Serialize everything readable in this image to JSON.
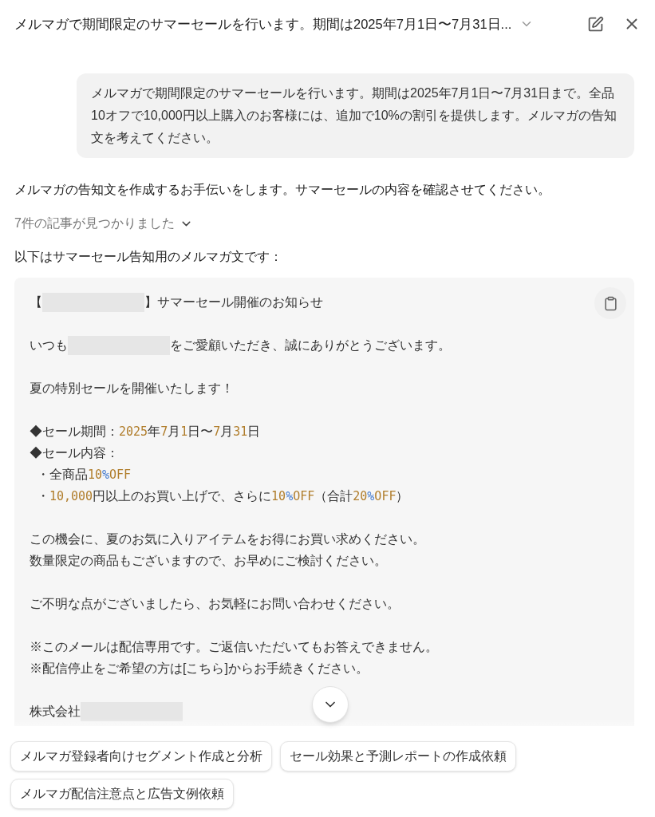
{
  "header": {
    "title": "メルマガで期間限定のサマーセールを行います。期間は2025年7月1日〜7月31日..."
  },
  "user_message": {
    "text": "メルマガで期間限定のサマーセールを行います。期間は2025年7月1日〜7月31日まで。全品10オフで10,000円以上購入のお客様には、追加で10%の割引を提供します。メルマガの告知文を考えてください。"
  },
  "assistant_intro": "メルマガの告知文を作成するお手伝いをします。サマーセールの内容を確認させてください。",
  "sources": {
    "label": "7件の記事が見つかりました",
    "expanded": false
  },
  "lead": "以下はサマーセール告知用のメルマガ文です：",
  "code_block": {
    "lines": [
      {
        "kind": "text",
        "segments": [
          {
            "kind": "plain",
            "text": "【"
          },
          {
            "kind": "redacted"
          },
          {
            "kind": "plain",
            "text": "】サマーセール開催のお知らせ"
          }
        ]
      },
      {
        "kind": "blank"
      },
      {
        "kind": "text",
        "segments": [
          {
            "kind": "plain",
            "text": "いつも"
          },
          {
            "kind": "redacted"
          },
          {
            "kind": "plain",
            "text": "をご愛顧いただき、誠にありがとうございます。"
          }
        ]
      },
      {
        "kind": "blank"
      },
      {
        "kind": "text",
        "segments": [
          {
            "kind": "plain",
            "text": "夏の特別セールを開催いたします！"
          }
        ]
      },
      {
        "kind": "blank"
      },
      {
        "kind": "text",
        "segments": [
          {
            "kind": "plain",
            "text": "◆セール期間："
          },
          {
            "kind": "number",
            "text": "2025"
          },
          {
            "kind": "plain",
            "text": "年"
          },
          {
            "kind": "number",
            "text": "7"
          },
          {
            "kind": "plain",
            "text": "月"
          },
          {
            "kind": "number",
            "text": "1"
          },
          {
            "kind": "plain",
            "text": "日〜"
          },
          {
            "kind": "number",
            "text": "7"
          },
          {
            "kind": "plain",
            "text": "月"
          },
          {
            "kind": "number",
            "text": "31"
          },
          {
            "kind": "plain",
            "text": "日"
          }
        ]
      },
      {
        "kind": "text",
        "segments": [
          {
            "kind": "plain",
            "text": "◆セール内容："
          }
        ]
      },
      {
        "kind": "text",
        "segments": [
          {
            "kind": "plain",
            "text": "  ・全商品"
          },
          {
            "kind": "number",
            "text": "10"
          },
          {
            "kind": "symbol",
            "text": "%"
          },
          {
            "kind": "number",
            "text": "OFF"
          }
        ]
      },
      {
        "kind": "text",
        "segments": [
          {
            "kind": "plain",
            "text": "  ・"
          },
          {
            "kind": "number",
            "text": "10,000"
          },
          {
            "kind": "plain",
            "text": "円以上のお買い上げで、さらに"
          },
          {
            "kind": "number",
            "text": "10"
          },
          {
            "kind": "symbol",
            "text": "%"
          },
          {
            "kind": "number",
            "text": "OFF"
          },
          {
            "kind": "plain",
            "text": "（合計"
          },
          {
            "kind": "number",
            "text": "20"
          },
          {
            "kind": "symbol",
            "text": "%"
          },
          {
            "kind": "number",
            "text": "OFF"
          },
          {
            "kind": "plain",
            "text": "）"
          }
        ]
      },
      {
        "kind": "blank"
      },
      {
        "kind": "text",
        "segments": [
          {
            "kind": "plain",
            "text": "この機会に、夏のお気に入りアイテムをお得にお買い求めください。"
          }
        ]
      },
      {
        "kind": "text",
        "segments": [
          {
            "kind": "plain",
            "text": "数量限定の商品もございますので、お早めにご検討ください。"
          }
        ]
      },
      {
        "kind": "blank"
      },
      {
        "kind": "text",
        "segments": [
          {
            "kind": "plain",
            "text": "ご不明な点がございましたら、お気軽にお問い合わせください。"
          }
        ]
      },
      {
        "kind": "blank"
      },
      {
        "kind": "text",
        "segments": [
          {
            "kind": "plain",
            "text": "※このメールは配信専用です。ご返信いただいてもお答えできません。"
          }
        ]
      },
      {
        "kind": "text",
        "segments": [
          {
            "kind": "plain",
            "text": "※配信停止をご希望の方は[こちら]からお手続きください。"
          }
        ]
      },
      {
        "kind": "blank"
      },
      {
        "kind": "text",
        "segments": [
          {
            "kind": "plain",
            "text": "株式会社"
          },
          {
            "kind": "redacted"
          }
        ]
      }
    ]
  },
  "suggestions": [
    "メルマガ登録者向けセグメント作成と分析",
    "セール効果と予測レポートの作成依頼",
    "メルマガ配信注意点と広告文例依頼"
  ]
}
